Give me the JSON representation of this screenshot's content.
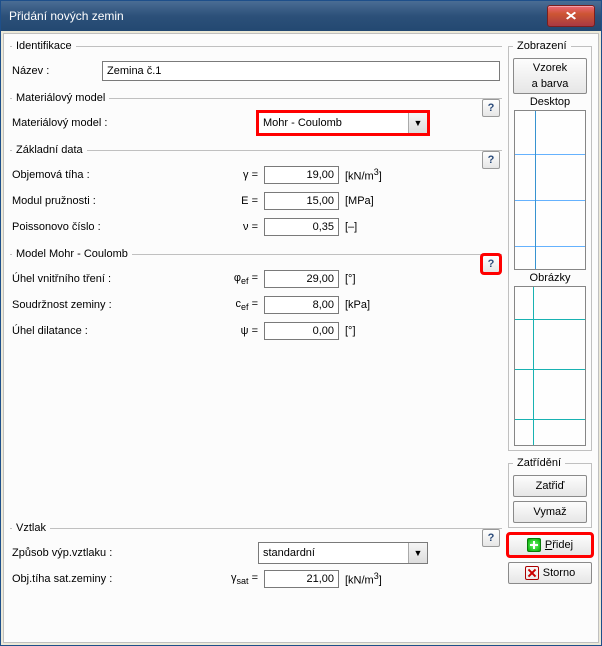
{
  "window": {
    "title": "Přidání nových zemin"
  },
  "identifikace": {
    "legend": "Identifikace",
    "name_label": "Název :",
    "name_value": "Zemina č.1"
  },
  "material_model": {
    "legend": "Materiálový model",
    "label": "Materiálový model :",
    "value": "Mohr - Coulomb"
  },
  "zakladni": {
    "legend": "Základní data",
    "gamma_label": "Objemová tíha :",
    "gamma_sym": "γ =",
    "gamma_val": "19,00",
    "gamma_unit": "[kN/m³]",
    "E_label": "Modul pružnosti :",
    "E_sym": "E =",
    "E_val": "15,00",
    "E_unit": "[MPa]",
    "nu_label": "Poissonovo číslo :",
    "nu_sym": "ν =",
    "nu_val": "0,35",
    "nu_unit": "[–]"
  },
  "mohr": {
    "legend": "Model Mohr - Coulomb",
    "phi_label": "Úhel vnitřního tření :",
    "phi_sym": "φef =",
    "phi_val": "29,00",
    "phi_unit": "[°]",
    "c_label": "Soudržnost zeminy :",
    "c_sym": "cef =",
    "c_val": "8,00",
    "c_unit": "[kPa]",
    "psi_label": "Úhel dilatance :",
    "psi_sym": "ψ =",
    "psi_val": "0,00",
    "psi_unit": "[°]"
  },
  "vztlak": {
    "legend": "Vztlak",
    "mode_label": "Způsob výp.vztlaku :",
    "mode_value": "standardní",
    "gsat_label": "Obj.tíha sat.zeminy :",
    "gsat_sym": "γsat =",
    "gsat_val": "21,00",
    "gsat_unit": "[kN/m³]"
  },
  "side": {
    "zobrazeni_legend": "Zobrazení",
    "vzorek1": "Vzorek",
    "vzorek2": "a barva",
    "desktop_label": "Desktop",
    "obrazky_label": "Obrázky",
    "zatrideni_legend": "Zatřídění",
    "zatrid": "Zatřiď",
    "vymaz": "Vymaž",
    "pridej": "Přidej",
    "storno": "Storno"
  }
}
